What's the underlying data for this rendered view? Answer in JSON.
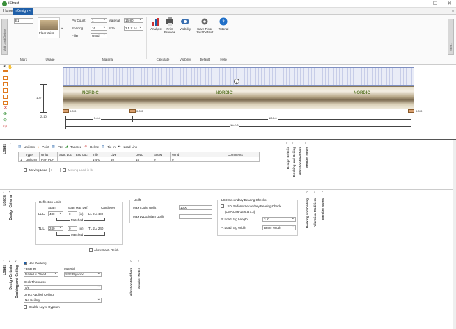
{
  "window": {
    "title": "iStruct",
    "minimize": "–",
    "maximize": "☐",
    "close": "✕"
  },
  "tabs": [
    {
      "label": "Home"
    },
    {
      "label": "m0esign ×"
    }
  ],
  "ribbon": {
    "left_strip": "Add Load/Options",
    "right_strip": "Sket...",
    "mark": {
      "value": "B1",
      "label": "Mark"
    },
    "usage": {
      "value": "Floor Joist",
      "label": "Usage"
    },
    "material": {
      "ply_count_label": "Ply Count",
      "ply_count": "1",
      "material_label": "Material",
      "material_value": "16-80",
      "spacing_label": "Spacing",
      "spacing": "16",
      "size_label": "Size",
      "size": "2.5 X 14",
      "filler_label": "Filler",
      "filler": "Used",
      "label": "Material"
    },
    "calculate": {
      "analyze": "Analyze",
      "print_preview": "Print Preview",
      "label": "Calculate"
    },
    "visibility": {
      "visibility": "Visibility",
      "label": "Visibility"
    },
    "default": {
      "save_floor": "Save Floor Joist Default",
      "label": "Default"
    },
    "help": {
      "tutorial": "Tutorial",
      "label": "Help"
    }
  },
  "diagram": {
    "joist_label": "NORDIC",
    "left_dim": "1'-6\"",
    "left_dim_b": "2'-10\"",
    "support_left": "0-0-0",
    "support_mid": "0-0-0",
    "support_right": "0-0-0",
    "span1": "5-0-0",
    "span2": "12-0-0",
    "total": "18-2-0",
    "marker": "1"
  },
  "loads_panel": {
    "side_tab": "Loads",
    "toolbar": [
      "Uniform",
      "Point",
      "PLI",
      "Tapered",
      "Delete",
      "Tie-In",
      "Load Link"
    ],
    "columns": [
      "Type",
      "Units",
      "Start Loc",
      "End Loc",
      "Trib",
      "Live",
      "Dead",
      "Snow",
      "Wind",
      "Comments"
    ],
    "row": {
      "index": "1",
      "type": "Uniform",
      "units": "PSF PLF",
      "start": "",
      "end": "",
      "trib": "1-4-0",
      "live": "40",
      "dead": "15",
      "snow": "0",
      "wind": "0",
      "comments": ""
    },
    "moving_load_label": "Moving Load",
    "moving_load_value": "0",
    "moving_load_in_lb": "Moving Load in lb.",
    "right_tabs": [
      "Design Criteria",
      "Decking and Ceiling",
      "Vibration Modifiers",
      "Member Notes"
    ]
  },
  "criteria_panel": {
    "side_tabs": [
      "Loads",
      "Design Criteria"
    ],
    "deflection_title": "Deflection Limit",
    "span_label": "Span",
    "span_max_label": "Span Max Def.",
    "cantilever_label": "Cantilever",
    "ll_label": "LL L/",
    "ll_value": "480",
    "ll_in": "0",
    "ll_in_unit": "(in)",
    "ll_cant": "LL 2L/ 480",
    "tl_label": "TL L/",
    "tl_value": "240",
    "tl_in": "0",
    "tl_in_unit": "(in)",
    "tl_cant": "TL 2L/ 240",
    "matched": "Matched",
    "allow_cant": "Allow Cant. Reinf.",
    "uplift_title": "Uplift",
    "max_ijoist_label": "Max I-Joist Uplift",
    "max_ijoist_value": "1000",
    "max_lvl_label": "Max LVL/Glulam Uplift",
    "max_lvl_value": "",
    "lsd_title": "LSD Secondary Bearing Checks",
    "lsd_perform": "LSD Perform Secondary Bearing Check",
    "lsd_std": "(CSA O86-14 6.5.7.3)",
    "pt_len_label": "Pt Load Brg Length",
    "pt_len_value": "3.5\"",
    "pt_width_label": "Pt Load Brg Width",
    "pt_width_value": "Beam Width",
    "right_tabs": [
      "Decking and Ceiling",
      "Vibration Modifiers",
      "Member Notes"
    ]
  },
  "decking_panel": {
    "side_tabs": [
      "Loads",
      "Design Criteria",
      "Decking and Ceiling"
    ],
    "has_decking": "Has Decking",
    "fastener_label": "Fastener",
    "fastener_value": "Nailed & Glued",
    "material_label": "Material",
    "material_value": "SPF Plywood",
    "thickness_label": "Deck Thickness",
    "thickness_value": "5/8\"",
    "ceiling_label": "Direct Applied Ceiling",
    "ceiling_value": "No Ceiling",
    "double_layer": "Double Layer Gypsum",
    "right_tabs": [
      "Vibration Modifiers",
      "Member Notes"
    ]
  },
  "colors": {
    "accent": "#1f5fa8",
    "toolbar_orange": "#e07a1f",
    "support": "#d9a070"
  }
}
